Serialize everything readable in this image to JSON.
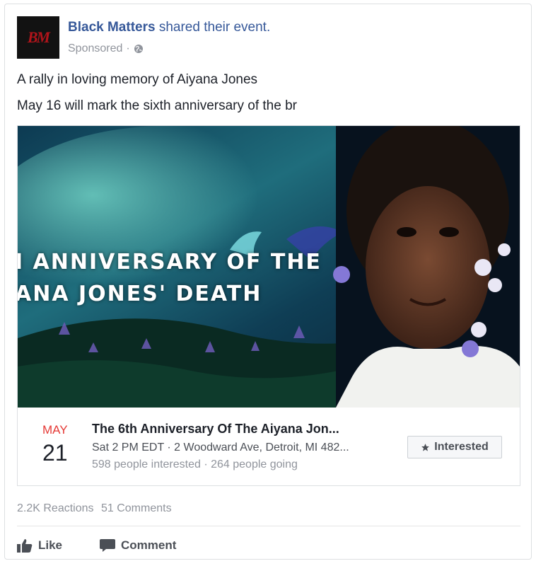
{
  "post": {
    "page_name": "Black Matters",
    "shared_text": "shared their",
    "event_word": "event.",
    "avatar_text": "BM",
    "sponsored": "Sponsored",
    "sep": "·",
    "line1": "A rally in loving memory of Aiyana Jones",
    "line2": "May 16 will mark the sixth anniversary of the br"
  },
  "banner": {
    "line1": "H ANNIVERSARY OF THE",
    "line2": "ANA JONES' DEATH"
  },
  "event": {
    "month": "MAY",
    "day": "21",
    "title": "The 6th Anniversary Of The Aiyana Jon...",
    "when_where": "Sat 2 PM EDT · 2 Woodward Ave, Detroit, MI 482...",
    "stats": "598 people interested · 264 people going",
    "interested_label": "Interested"
  },
  "footer": {
    "reactions": "2.2K Reactions",
    "comments": "51 Comments",
    "like_label": "Like",
    "comment_label": "Comment"
  },
  "colors": {
    "link": "#365899",
    "month": "#e53935",
    "muted": "#90949c"
  },
  "icons": [
    "globe-icon",
    "star-icon",
    "thumbs-up-icon",
    "comment-bubble-icon"
  ]
}
